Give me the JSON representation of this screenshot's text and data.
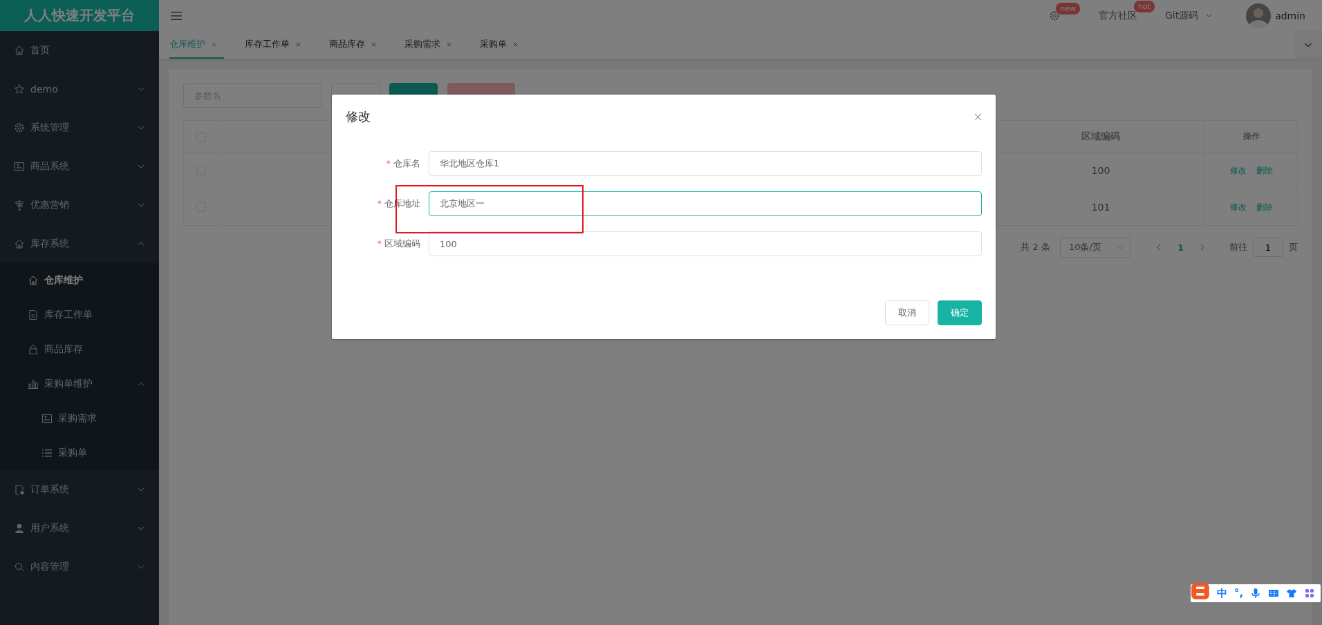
{
  "header": {
    "logo": "人人快速开发平台",
    "actions": [
      {
        "kind": "gear",
        "badge": "new"
      },
      {
        "kind": "link",
        "label": "官方社区",
        "badge": "hot"
      },
      {
        "kind": "dropdown",
        "label": "Git源码"
      }
    ],
    "user": {
      "name": "admin"
    }
  },
  "sidebar": {
    "items": [
      {
        "label": "首页",
        "selected": false
      },
      {
        "label": "demo",
        "selected": false,
        "expanded": false
      },
      {
        "label": "系统管理",
        "selected": false,
        "expanded": false
      },
      {
        "label": "商品系统",
        "selected": false,
        "expanded": false
      },
      {
        "label": "优惠营销",
        "selected": false,
        "expanded": false
      },
      {
        "label": "库存系统",
        "selected": false,
        "expanded": true,
        "children": [
          {
            "label": "仓库维护",
            "selected": true
          },
          {
            "label": "库存工作单",
            "selected": false
          },
          {
            "label": "商品库存",
            "selected": false
          },
          {
            "label": "采购单维护",
            "selected": false,
            "expanded": true,
            "children": [
              {
                "label": "采购需求",
                "selected": false
              },
              {
                "label": "采购单",
                "selected": false
              }
            ]
          }
        ]
      },
      {
        "label": "订单系统",
        "selected": false,
        "expanded": false
      },
      {
        "label": "用户系统",
        "selected": false,
        "expanded": false
      },
      {
        "label": "内容管理",
        "selected": false,
        "expanded": false
      }
    ]
  },
  "tabs": [
    {
      "label": "仓库维护",
      "selected": true
    },
    {
      "label": "库存工作单",
      "selected": false
    },
    {
      "label": "商品库存",
      "selected": false
    },
    {
      "label": "采购需求",
      "selected": false
    },
    {
      "label": "采购单",
      "selected": false
    }
  ],
  "toolbar": {
    "search": {
      "placeholder": "参数名"
    },
    "buttons": [
      {
        "kind": "default"
      },
      {
        "kind": "primary"
      },
      {
        "kind": "danger"
      }
    ]
  },
  "table": {
    "header_checked": false,
    "columns": [
      {
        "label": "区域编码"
      },
      {
        "label": "操作"
      }
    ],
    "rows": [
      {
        "checked": false,
        "region_code": "100",
        "actions": [
          "修改",
          "删除"
        ]
      },
      {
        "checked": false,
        "region_code": "101",
        "actions": [
          "修改",
          "删除"
        ]
      }
    ]
  },
  "pagination": {
    "total": "共 2 条",
    "page_size": "10条/页",
    "pages": [
      {
        "label": "1",
        "selected": true
      }
    ],
    "goto_label": "前往",
    "goto_value": "1",
    "goto_suffix": "页"
  },
  "dialog": {
    "title": "修改",
    "fields": [
      {
        "label": "仓库名",
        "required_mark": "*",
        "value": "华北地区仓库1",
        "focused": false
      },
      {
        "label": "仓库地址",
        "required_mark": "*",
        "value": "北京地区一",
        "focused": true
      },
      {
        "label": "区域编码",
        "required_mark": "*",
        "value": "100",
        "focused": false
      }
    ],
    "buttons": [
      {
        "label": "取消",
        "kind": "default"
      },
      {
        "label": "确定",
        "kind": "primary"
      }
    ]
  },
  "ime": {
    "items": [
      "中",
      "°,"
    ]
  }
}
